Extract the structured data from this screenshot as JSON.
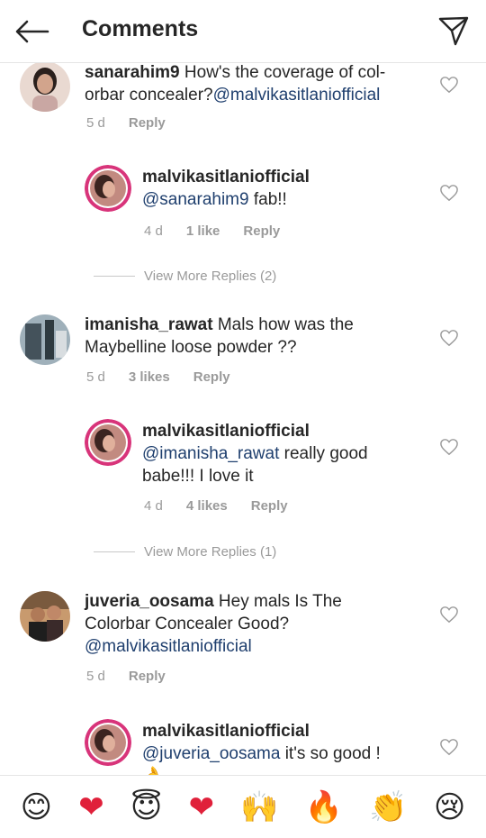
{
  "header": {
    "title": "Comments"
  },
  "comments": [
    {
      "username": "sanarahim9",
      "text": "How's the coverage of col-orbar concealer?",
      "mention": "@malvikasitlaniofficial",
      "age": "5 d",
      "reply": "Reply"
    },
    {
      "username": "malvikasitlaniofficial",
      "mention": "@sanarahim9",
      "text": "fab!!",
      "age": "4 d",
      "likes": "1 like",
      "reply": "Reply"
    },
    {
      "username": "imanisha_rawat",
      "text": "Mals how was the Maybelline loose powder ??",
      "age": "5 d",
      "likes": "3 likes",
      "reply": "Reply"
    },
    {
      "username": "malvikasitlaniofficial",
      "mention": "@imanisha_rawat",
      "text": "really good babe!!! I love it",
      "age": "4 d",
      "likes": "4 likes",
      "reply": "Reply"
    },
    {
      "username": "juveria_oosama",
      "text": "Hey mals Is The Colorbar Concealer Good?",
      "mention": "@malvikasitlaniofficial",
      "age": "5 d",
      "reply": "Reply"
    },
    {
      "username": "malvikasitlaniofficial",
      "mention": "@juveria_oosama",
      "text": "it's so good ! 👌"
    }
  ],
  "view_more": [
    "View More Replies (2)",
    "View More Replies (1)"
  ],
  "emojis": [
    "😊",
    "❤",
    "😇",
    "❤",
    "🙌",
    "🔥",
    "👏",
    "😢"
  ],
  "colors": {
    "mention": "#1f3f6e",
    "meta": "#9a9a9a",
    "heart_red": "#e0203a"
  }
}
